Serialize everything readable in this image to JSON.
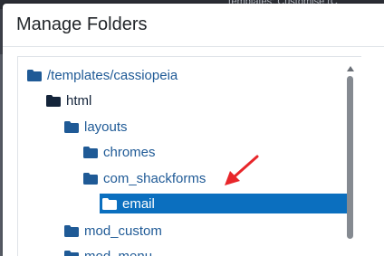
{
  "background": {
    "top_text": "Templates: Customise (C"
  },
  "modal": {
    "title": "Manage Folders"
  },
  "tree": {
    "items": [
      {
        "label": "/templates/cassiopeia",
        "level": 0,
        "icon": "folder-icon",
        "selected": false
      },
      {
        "label": "html",
        "level": 1,
        "icon": "folder-icon",
        "selected": false
      },
      {
        "label": "layouts",
        "level": 2,
        "icon": "folder-icon",
        "selected": false
      },
      {
        "label": "chromes",
        "level": 3,
        "icon": "folder-icon",
        "selected": false
      },
      {
        "label": "com_shackforms",
        "level": 3,
        "icon": "folder-icon",
        "selected": false
      },
      {
        "label": "email",
        "level": 4,
        "icon": "folder-icon",
        "selected": true
      },
      {
        "label": "mod_custom",
        "level": 2,
        "icon": "folder-icon",
        "selected": false
      },
      {
        "label": "mod_menu",
        "level": 2,
        "icon": "folder-icon",
        "selected": false
      }
    ]
  },
  "colors": {
    "folder": "#1f5a96",
    "folder_dark": "#14243a",
    "selected_bg": "#0b6fbf",
    "annotation_arrow": "#e8262a"
  }
}
